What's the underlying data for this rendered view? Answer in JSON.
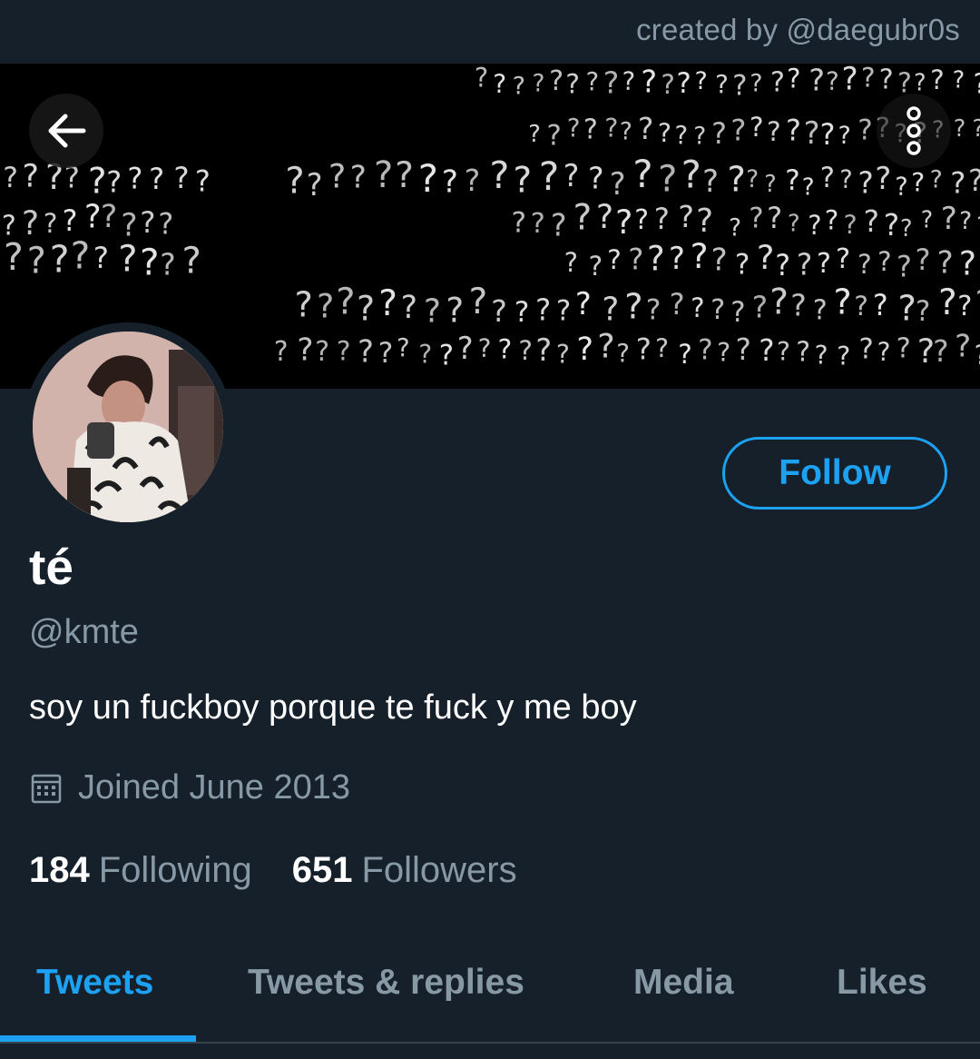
{
  "watermark": "created by @daegubr0s",
  "header": {
    "back_icon": "arrow-left-icon",
    "more_icon": "more-vertical-icon",
    "banner_glyph": "?"
  },
  "profile": {
    "name": "té",
    "handle": "@kmte",
    "bio": "soy un fuckboy porque te fuck y me boy",
    "joined": "Joined June 2013",
    "joined_icon": "calendar-icon",
    "follow_label": "Follow",
    "following_count": "184",
    "following_label": "Following",
    "followers_count": "651",
    "followers_label": "Followers"
  },
  "tabs": [
    {
      "label": "Tweets",
      "active": true
    },
    {
      "label": "Tweets & replies",
      "active": false
    },
    {
      "label": "Media",
      "active": false
    },
    {
      "label": "Likes",
      "active": false
    }
  ],
  "colors": {
    "background": "#15202b",
    "accent": "#1da1f2",
    "secondary_text": "#8899a6",
    "divider": "#38444d"
  }
}
